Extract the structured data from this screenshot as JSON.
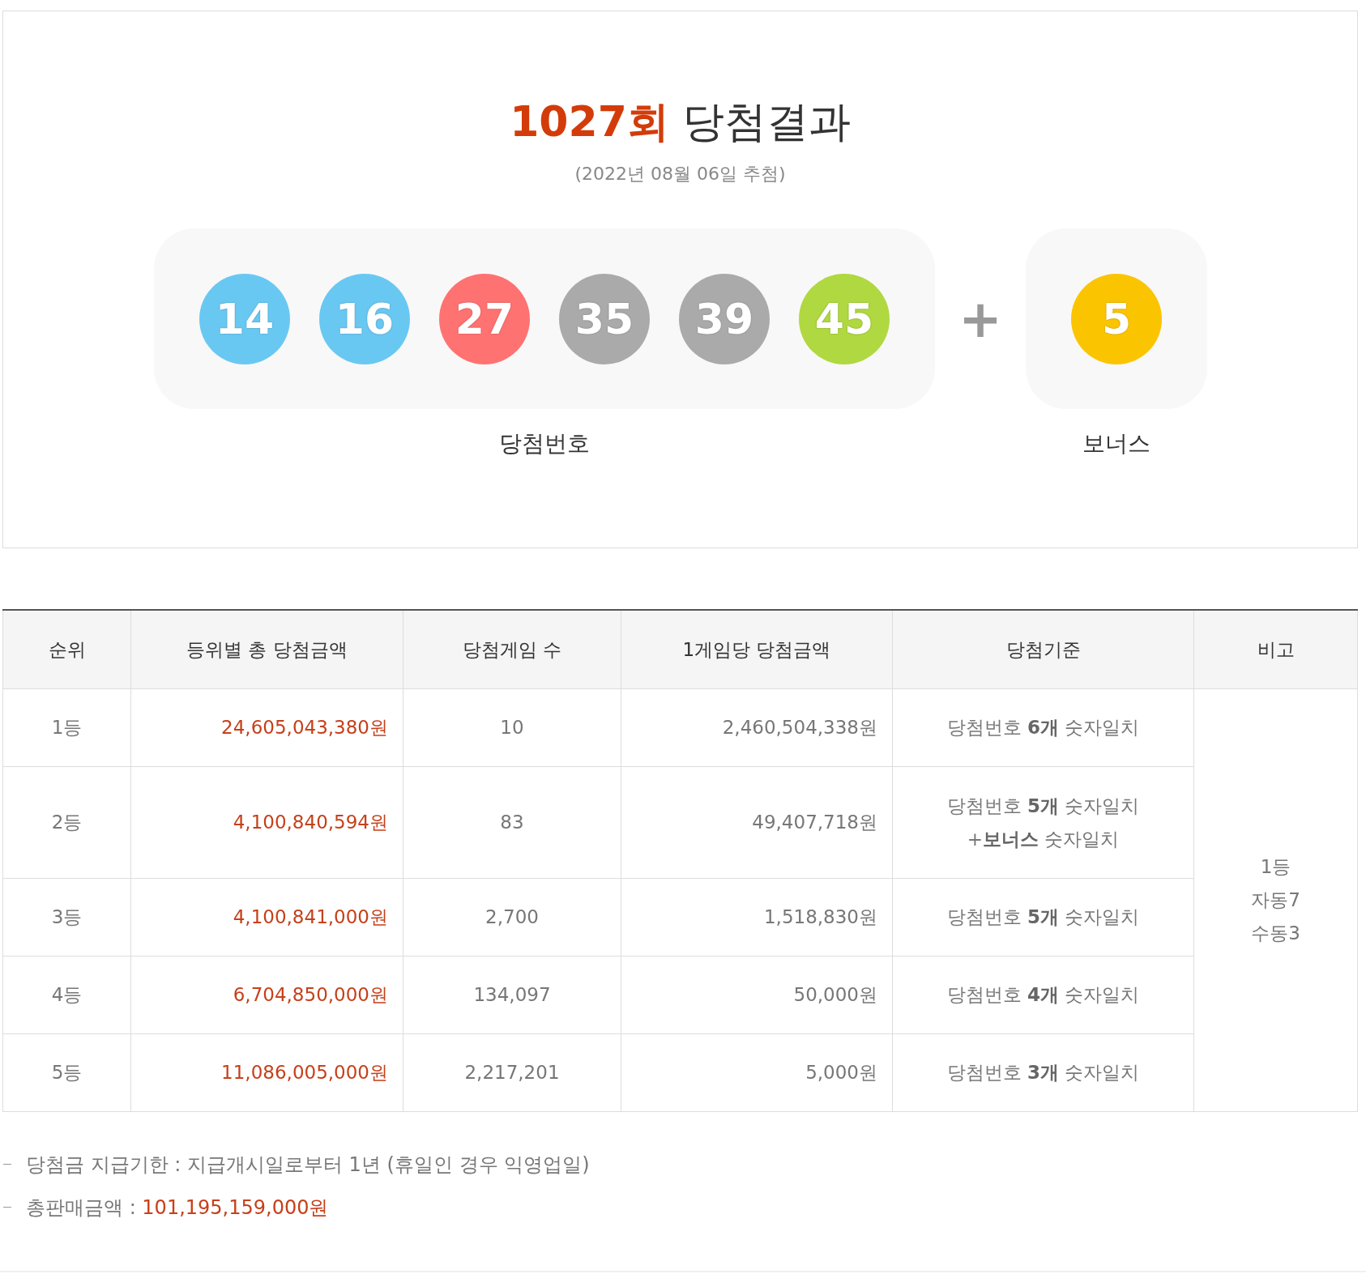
{
  "result": {
    "round": "1027회",
    "title": "당첨결과",
    "date": "(2022년 08월 06일 추첨)",
    "numbers": [
      {
        "value": "14",
        "color": "#69c8f2"
      },
      {
        "value": "16",
        "color": "#69c8f2"
      },
      {
        "value": "27",
        "color": "#ff7272"
      },
      {
        "value": "35",
        "color": "#aaaaaa"
      },
      {
        "value": "39",
        "color": "#aaaaaa"
      },
      {
        "value": "45",
        "color": "#b0d840"
      }
    ],
    "plus": "+",
    "bonus": {
      "value": "5",
      "color": "#fbc400"
    },
    "numbers_label": "당첨번호",
    "bonus_label": "보너스"
  },
  "table": {
    "columns": [
      "순위",
      "등위별 총 당첨금액",
      "당첨게임 수",
      "1게임당 당첨금액",
      "당첨기준",
      "비고"
    ],
    "rows": [
      {
        "rank": "1등",
        "total": "24,605,043,380원",
        "winners": "10",
        "per_game": "2,460,504,338원",
        "criteria": [
          "당첨번호 **6개** 숫자일치"
        ]
      },
      {
        "rank": "2등",
        "total": "4,100,840,594원",
        "winners": "83",
        "per_game": "49,407,718원",
        "criteria": [
          "당첨번호 **5개** 숫자일치",
          "+**보너스** 숫자일치"
        ]
      },
      {
        "rank": "3등",
        "total": "4,100,841,000원",
        "winners": "2,700",
        "per_game": "1,518,830원",
        "criteria": [
          "당첨번호 **5개** 숫자일치"
        ]
      },
      {
        "rank": "4등",
        "total": "6,704,850,000원",
        "winners": "134,097",
        "per_game": "50,000원",
        "criteria": [
          "당첨번호 **4개** 숫자일치"
        ]
      },
      {
        "rank": "5등",
        "total": "11,086,005,000원",
        "winners": "2,217,201",
        "per_game": "5,000원",
        "criteria": [
          "당첨번호 **3개** 숫자일치"
        ]
      }
    ],
    "note": [
      "1등",
      "자동7",
      "수동3"
    ]
  },
  "footnotes": [
    {
      "label": "당첨금 지급기한 : ",
      "value": "지급개시일로부터 1년 (휴일인 경우 익영업일)",
      "highlight": false
    },
    {
      "label": "총판매금액 : ",
      "value": "101,195,159,000원",
      "highlight": true
    }
  ]
}
